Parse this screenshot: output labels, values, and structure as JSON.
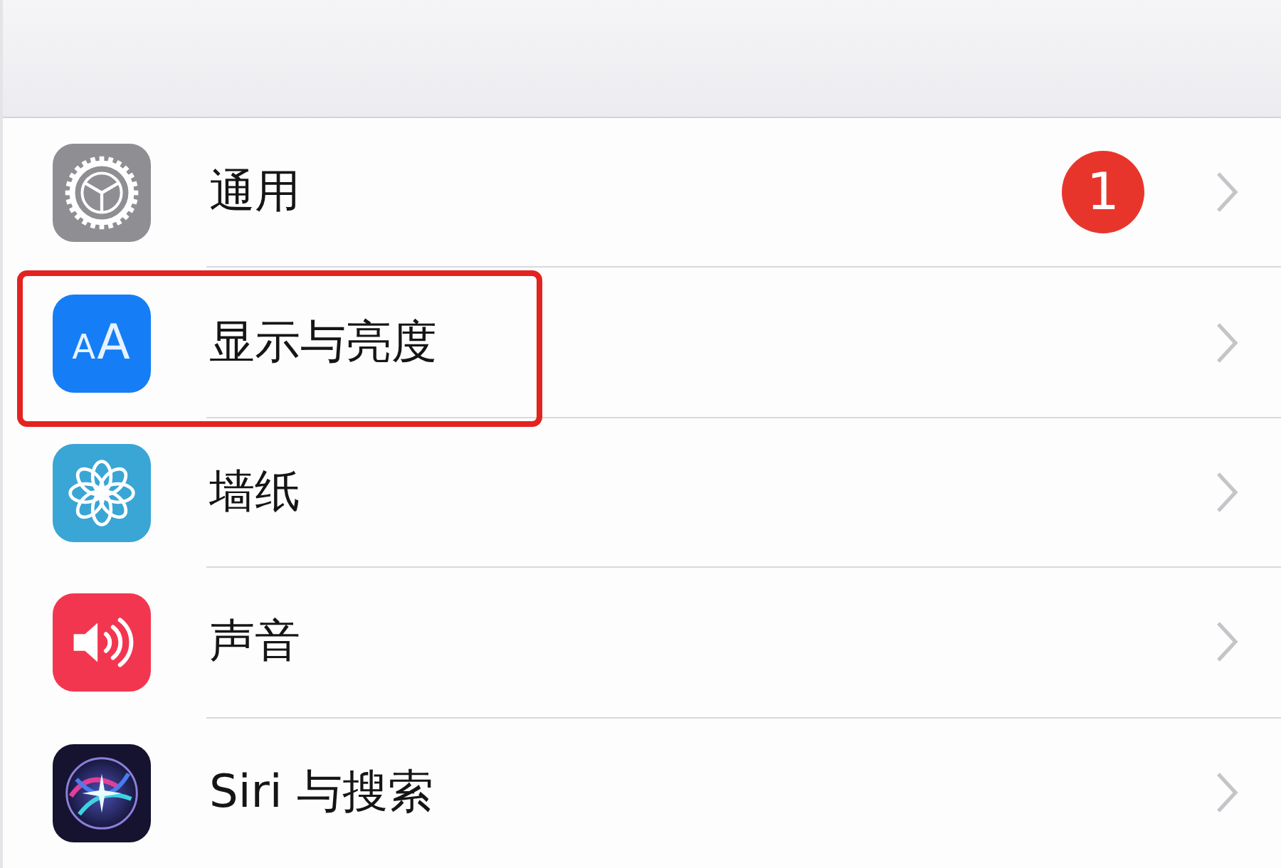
{
  "settings": [
    {
      "kind": "gear",
      "label": "通用",
      "badge": "1",
      "highlighted": false
    },
    {
      "kind": "text-size",
      "glyph": "AA",
      "label": "显示与亮度",
      "highlighted": true
    },
    {
      "kind": "flower",
      "label": "墙纸",
      "highlighted": false
    },
    {
      "kind": "speaker",
      "label": "声音",
      "highlighted": false
    },
    {
      "kind": "orb",
      "label": "Siri 与搜索",
      "highlighted": false
    }
  ]
}
